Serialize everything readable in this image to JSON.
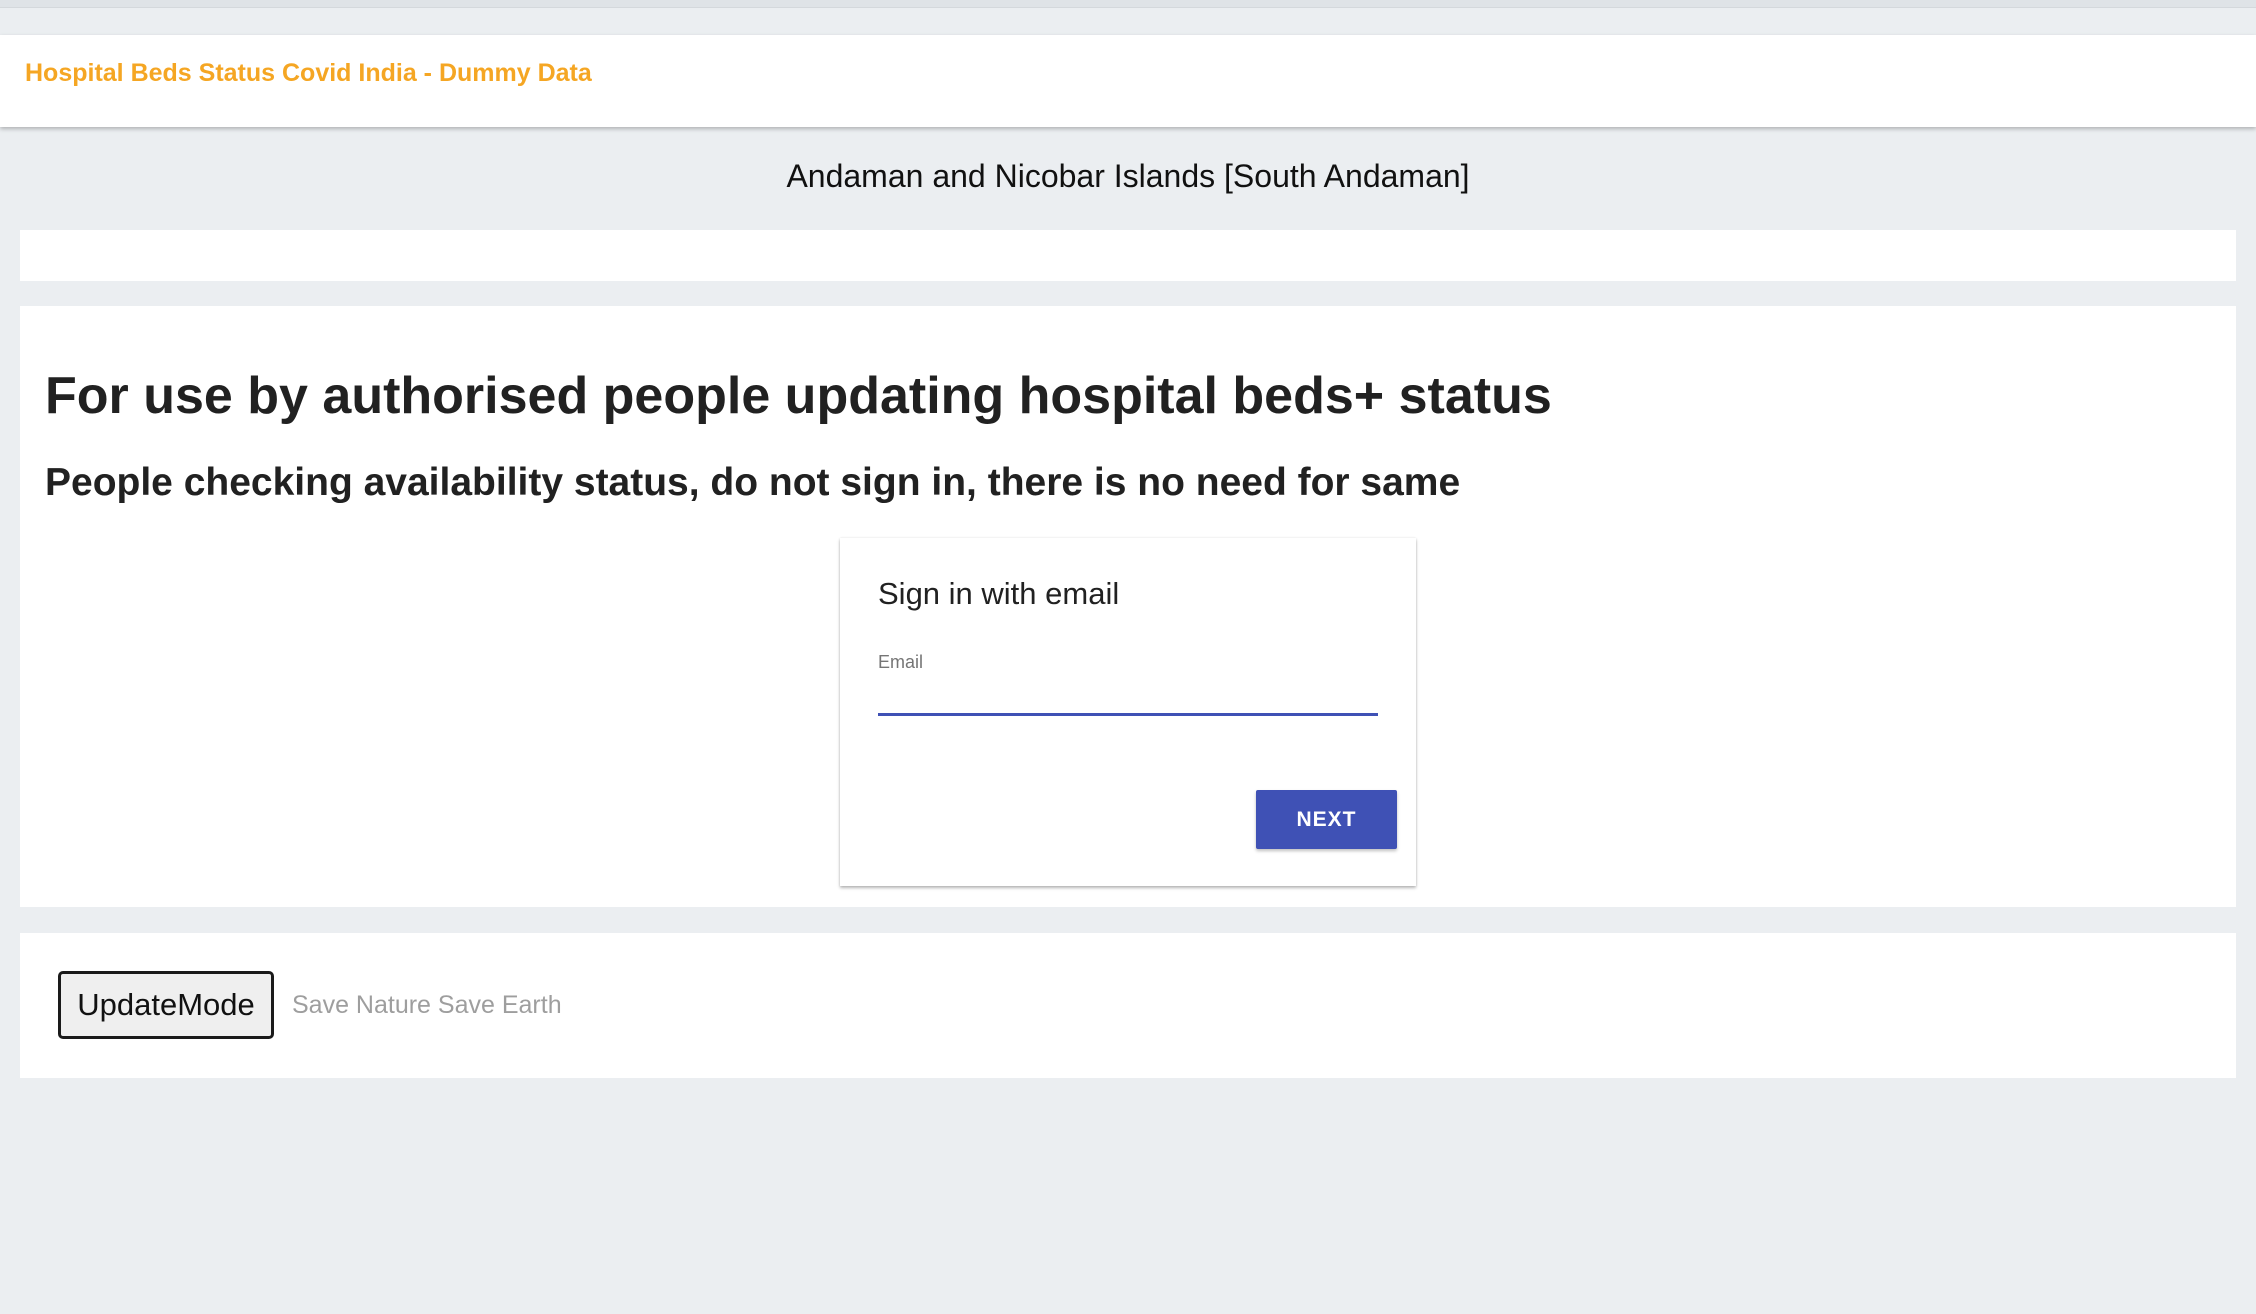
{
  "header": {
    "title": "Hospital Beds Status Covid India - Dummy Data",
    "title_color": "#f5a623"
  },
  "location": "Andaman and Nicobar Islands [South Andaman]",
  "main": {
    "heading": "For use by authorised people updating hospital beds+ status",
    "subheading": "People checking availability status, do not sign in, there is no need for same"
  },
  "signin": {
    "title": "Sign in with email",
    "email_label": "Email",
    "email_value": "",
    "next_label": "NEXT",
    "accent_color": "#3f51b5"
  },
  "footer": {
    "update_mode_label": "UpdateMode",
    "tagline": "Save Nature Save Earth"
  }
}
